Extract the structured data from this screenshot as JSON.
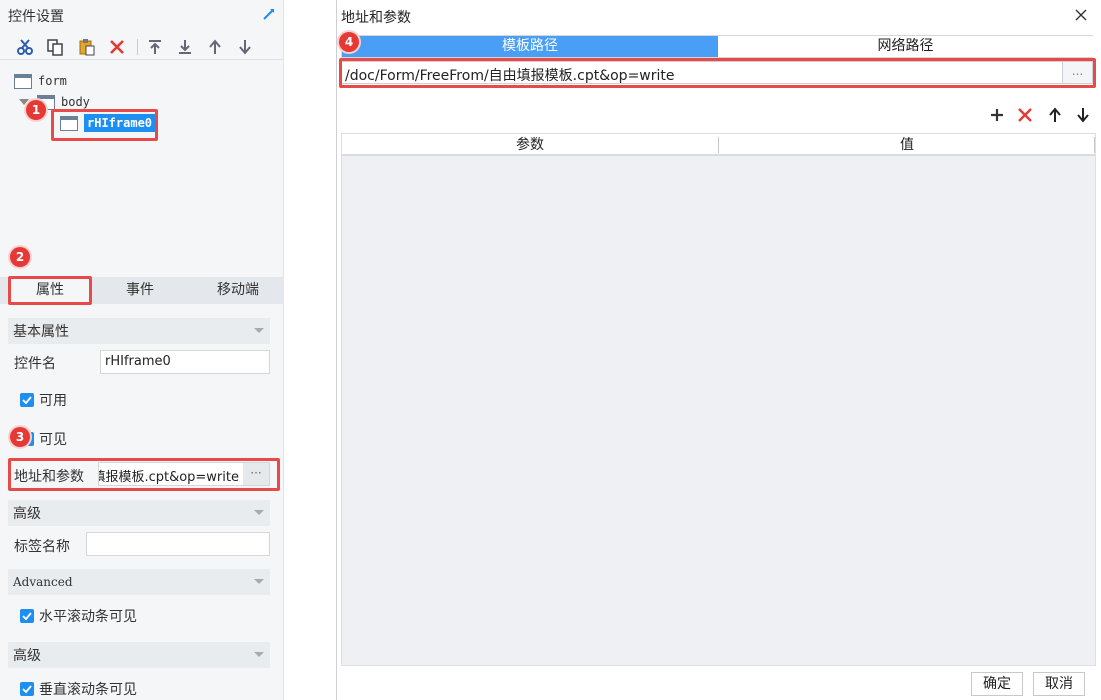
{
  "left_panel": {
    "title": "控件设置",
    "tree": {
      "root": "form",
      "body": "body",
      "selected": "rHIframe0"
    },
    "tabs": [
      "属性",
      "事件",
      "移动端"
    ],
    "sections": {
      "basic": "基本属性",
      "advanced_cn": "高级",
      "advanced_en": "Advanced",
      "advanced2_cn": "高级"
    },
    "widget_name_label": "控件名",
    "widget_name_value": "rHIframe0",
    "enabled_label": "可用",
    "visible_label": "可见",
    "url_label": "地址和参数",
    "url_value": "填报模板.cpt&op=write",
    "url_more": "···",
    "tag_label": "标签名称",
    "tag_value": "",
    "hscroll_label": "水平滚动条可见",
    "vscroll_label": "垂直滚动条可见"
  },
  "annotations": {
    "badge1": "1",
    "badge2": "2",
    "badge3": "3",
    "badge4": "4"
  },
  "dialog": {
    "title": "地址和参数",
    "tabs": [
      "模板路径",
      "网络路径"
    ],
    "path_value": "/doc/Form/FreeFrom/自由填报模板.cpt&op=write",
    "path_more": "...",
    "grid_headers": [
      "参数",
      "值"
    ],
    "ok_label": "确定",
    "cancel_label": "取消"
  },
  "colors": {
    "accent": "#1f8ef1",
    "tab_active": "#4a9ef6",
    "annotation_red": "#e53935",
    "delete_red": "#e53935"
  },
  "icons": {
    "toolbar": [
      "cut-icon",
      "copy-icon",
      "paste-icon",
      "delete-icon",
      "move-top-icon",
      "move-bottom-icon",
      "move-up-icon",
      "move-down-icon"
    ],
    "params_toolbar": [
      "add-icon",
      "delete-icon",
      "arrow-up-icon",
      "arrow-down-icon"
    ]
  }
}
